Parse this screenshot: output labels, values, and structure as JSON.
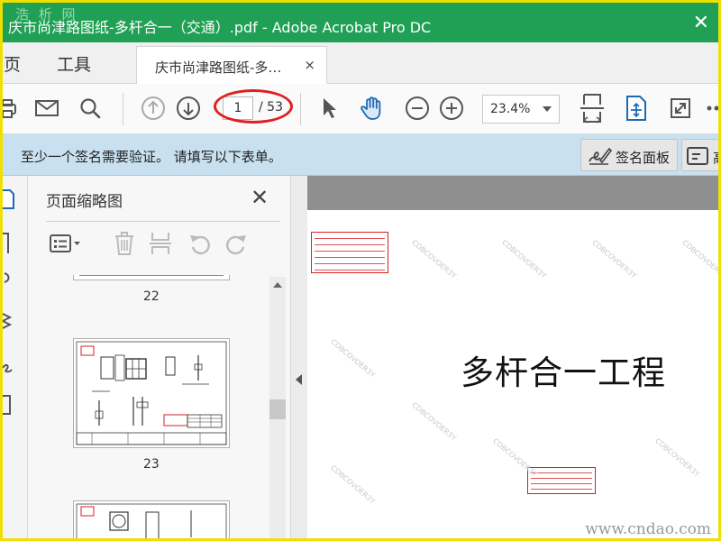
{
  "window": {
    "watermark": "浩 析 网",
    "title": "庆市尚津路图纸-多杆合一（交通）.pdf - Adobe Acrobat Pro DC",
    "close_glyph": "✕"
  },
  "menubar": {
    "home_label": "主页",
    "tools_label": "工具",
    "doc_tab": {
      "label": "庆市尚津路图纸-多…",
      "close_glyph": "×"
    }
  },
  "toolbar": {
    "icons": [
      "print-icon",
      "mail-icon",
      "search-icon",
      "prev-page-icon",
      "next-page-icon",
      "select-cursor-icon",
      "hand-tool-icon",
      "zoom-out-icon",
      "zoom-in-icon",
      "fit-page-icon",
      "scroll-mode-icon",
      "fullscreen-icon",
      "more-icon"
    ],
    "page_current": "1",
    "page_total": "/ 53",
    "zoom": "23.4%",
    "accent_color": "#e02020"
  },
  "notice": {
    "text": "至少一个签名需要验证。   请填写以下表单。",
    "sign_panel_label": "签名面板",
    "next_label": "高"
  },
  "panel": {
    "title": "页面缩略图",
    "close_glyph": "✕",
    "tools": [
      "thumbnail-options-icon",
      "delete-page-icon",
      "insert-page-icon",
      "undo-icon",
      "redo-icon"
    ],
    "thumbnails": [
      {
        "number": "22"
      },
      {
        "number": "23"
      },
      {
        "number": ""
      }
    ]
  },
  "document": {
    "title": "多杆合一工程",
    "watermark_text": "CDBCOVOER3Y",
    "site_watermark": "www.cndao.com",
    "background": "#ffffff",
    "stamp_color": "#d42020"
  }
}
